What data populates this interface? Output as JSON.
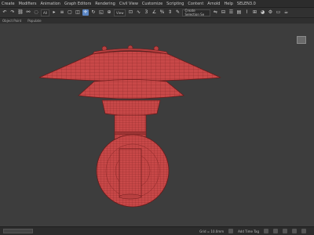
{
  "menu": {
    "items": [
      "Create",
      "Modifiers",
      "Animation",
      "Graph Editors",
      "Rendering",
      "Civil View",
      "Customize",
      "Scripting",
      "Content",
      "Arnold",
      "Help",
      "SELEN3.0"
    ]
  },
  "toolbar": {
    "selection_filter": "All",
    "view_label": "View",
    "named_selection": "Create Selection Se"
  },
  "search": {
    "placeholder": "Type a"
  },
  "subbar": {
    "items": [
      "Object Paint",
      "Populate"
    ]
  },
  "status": {
    "grid_label": "Grid = 10.0mm",
    "time_tag_label": "Add Time Tag"
  },
  "colors": {
    "model_fill": "#c84848",
    "model_edges": "#7a1f1f",
    "viewport_bg": "#3d3d3d",
    "active_tool": "#5b86c5"
  }
}
